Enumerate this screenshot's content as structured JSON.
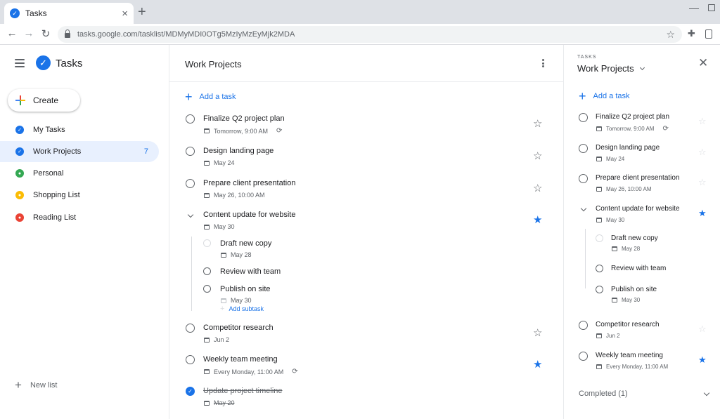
{
  "browser": {
    "tab_title": "Tasks",
    "tab_close": "×",
    "new_tab": "+",
    "url": "tasks.google.com/tasklist/MDMyMDI0OTg5MzIyMzEyMjk2MDA",
    "icons": [
      "back-icon",
      "forward-icon",
      "reload-icon",
      "lock-icon",
      "bookmark-star-icon",
      "extensions-icon",
      "profile-icon"
    ]
  },
  "app": {
    "title": "Tasks",
    "accent": "#1a73e8",
    "create_label": "Create",
    "new_list_label": "New list",
    "lists": [
      {
        "label": "My Tasks",
        "color": "#1a73e8",
        "count": ""
      },
      {
        "label": "Work Projects",
        "color": "#1a73e8",
        "count": "7",
        "active": true
      },
      {
        "label": "Personal",
        "color": "#34a853",
        "count": ""
      },
      {
        "label": "Shopping List",
        "color": "#fbbc04",
        "count": ""
      },
      {
        "label": "Reading List",
        "color": "#ea4335",
        "count": ""
      }
    ]
  },
  "main": {
    "title": "Work Projects",
    "add_task_label": "Add a task",
    "add_subtask_label": "Add subtask",
    "tasks": [
      {
        "title": "Finalize Q2 project plan",
        "due": "Tomorrow, 9:00 AM",
        "repeat": true,
        "starred": false
      },
      {
        "title": "Design landing page",
        "due": "May 24",
        "starred": false
      },
      {
        "title": "Prepare client presentation",
        "due": "May 26, 10:00 AM",
        "starred": false
      },
      {
        "title": "Content update for website",
        "due": "May 30",
        "starred": true,
        "expanded": true,
        "subtasks": [
          {
            "title": "Draft new copy",
            "due": "May 28"
          },
          {
            "title": "Review with team",
            "due": ""
          },
          {
            "title": "Publish on site",
            "due": "May 30"
          }
        ]
      },
      {
        "title": "Competitor research",
        "due": "Jun 2",
        "starred": false
      },
      {
        "title": "Weekly team meeting",
        "due": "Every Monday, 11:00 AM",
        "repeat": true,
        "starred": true
      },
      {
        "title": "Update project timeline",
        "due": "May 20",
        "completed": true
      }
    ]
  },
  "panel": {
    "overline": "TASKS",
    "title": "Work Projects",
    "add_task_label": "Add a task",
    "completed_label": "Completed (1)",
    "tasks": [
      {
        "title": "Finalize Q2 project plan",
        "due": "Tomorrow, 9:00 AM",
        "repeat": true,
        "starred": false
      },
      {
        "title": "Design landing page",
        "due": "May 24",
        "starred": false
      },
      {
        "title": "Prepare client presentation",
        "due": "May 26, 10:00 AM",
        "starred": false
      },
      {
        "title": "Content update for website",
        "due": "May 30",
        "starred": true,
        "subtasks": [
          {
            "title": "Draft new copy",
            "due": "May 28"
          },
          {
            "title": "Review with team",
            "due": ""
          },
          {
            "title": "Publish on site",
            "due": "May 30"
          }
        ]
      },
      {
        "title": "Competitor research",
        "due": "Jun 2",
        "starred": false
      },
      {
        "title": "Weekly team meeting",
        "due": "Every Monday, 11:00 AM",
        "starred": true
      }
    ]
  }
}
